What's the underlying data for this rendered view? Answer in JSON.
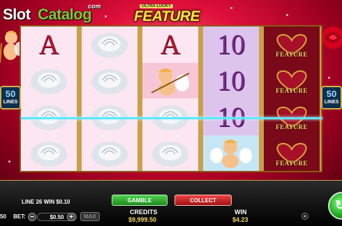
{
  "logo": {
    "slot": "Slot",
    "catalog": "Catalog",
    "com": "com"
  },
  "title": {
    "small": "ULTRA LUCKY",
    "main": "FEATURE"
  },
  "lines_badge": {
    "number": "50",
    "label": "LINES"
  },
  "reels": [
    [
      "A",
      "rose",
      "rose",
      "rose"
    ],
    [
      "rose",
      "rose",
      "rose",
      "rose"
    ],
    [
      "A",
      "cupid",
      "rose",
      "rose"
    ],
    [
      "10",
      "10",
      "10",
      "cupid"
    ],
    [
      "FEATURE",
      "FEATURE",
      "FEATURE",
      "FEATURE"
    ]
  ],
  "win_info": "LINE 26 WIN $0.10",
  "buttons": {
    "gamble": "GAMBLE",
    "collect": "COLLECT",
    "max": "MAX",
    "minus": "−",
    "plus": "+"
  },
  "credits": {
    "label": "CREDITS",
    "value": "$9,999.50"
  },
  "win": {
    "label": "WIN",
    "value": "$4.23"
  },
  "bet": {
    "label": "BET:",
    "value": "$0.50",
    "left_edge": "50"
  },
  "colors": {
    "payline": "#5fe6ff",
    "gamble": "#1c8a1c",
    "collect": "#a01010",
    "frame_gold": "#c9a04a"
  }
}
